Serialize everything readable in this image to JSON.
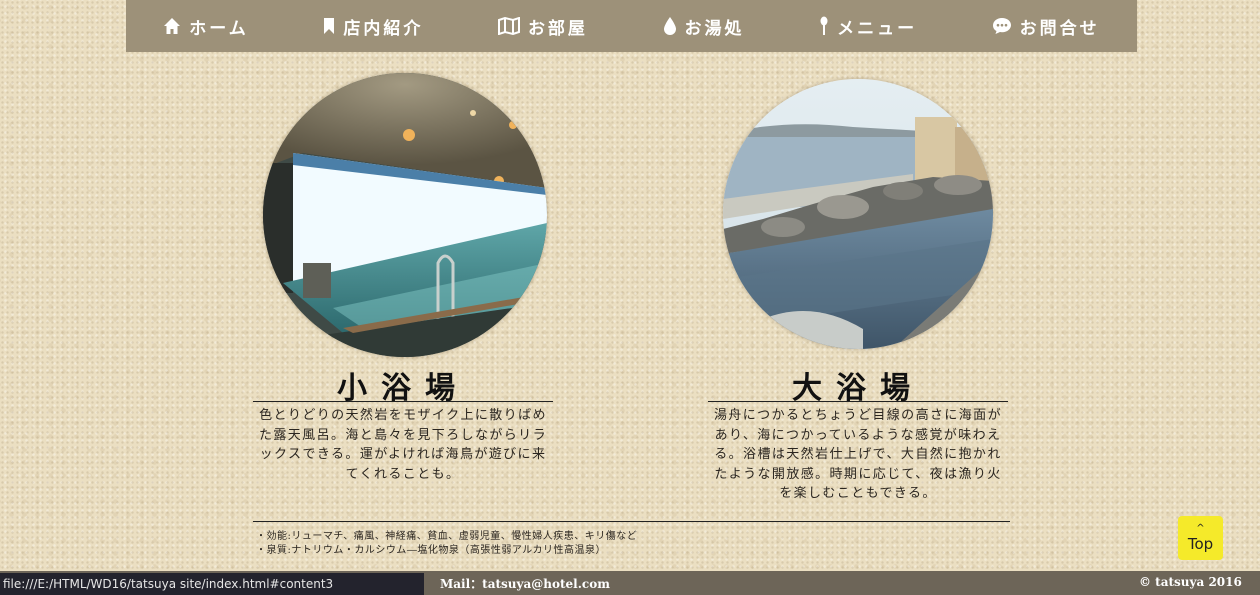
{
  "nav": {
    "items": [
      {
        "label": "ホーム",
        "icon": "home-icon"
      },
      {
        "label": "店内紹介",
        "icon": "bookmark-icon"
      },
      {
        "label": "お部屋",
        "icon": "map-icon"
      },
      {
        "label": "お湯処",
        "icon": "water-drop-icon"
      },
      {
        "label": "メニュー",
        "icon": "utensil-icon"
      },
      {
        "label": "お問合せ",
        "icon": "chat-bubble-icon"
      }
    ]
  },
  "baths": [
    {
      "title": "小浴場",
      "image": "indoor-bath-photo",
      "description": "色とりどりの天然岩をモザイク上に散りばめた露天風呂。海と島々を見下ろしながらリラックスできる。運がよければ海鳥が遊びに来てくれることも。"
    },
    {
      "title": "大浴場",
      "image": "outdoor-bath-photo",
      "description": "湯舟につかるとちょうど目線の高さに海面があり、海につかっているような感覚が味わえる。浴槽は天然岩仕上げで、大自然に抱かれたような開放感。時期に応じて、夜は漁り火を楽しむこともできる。"
    }
  ],
  "notes": {
    "effects": "・効能:リューマチ、痛風、神経痛、貧血、虚弱児童、慢性婦人疾患、キリ傷など",
    "spring": "・泉質:ナトリウム・カルシウム―塩化物泉（高張性弱アルカリ性高温泉）"
  },
  "top_button": {
    "label": "Top",
    "chevron": "^"
  },
  "footer": {
    "mail": "Mail：tatsuya@hotel.com",
    "copyright": "© tatsuya 2016"
  },
  "status_bar": {
    "url": "file:///E:/HTML/WD16/tatsuya site/index.html#content3"
  },
  "colors": {
    "nav_bg": "#9d9179",
    "footer_bg": "#6d6558",
    "top_button": "#f5ea2a",
    "page_bg": "#ebdfc2"
  }
}
